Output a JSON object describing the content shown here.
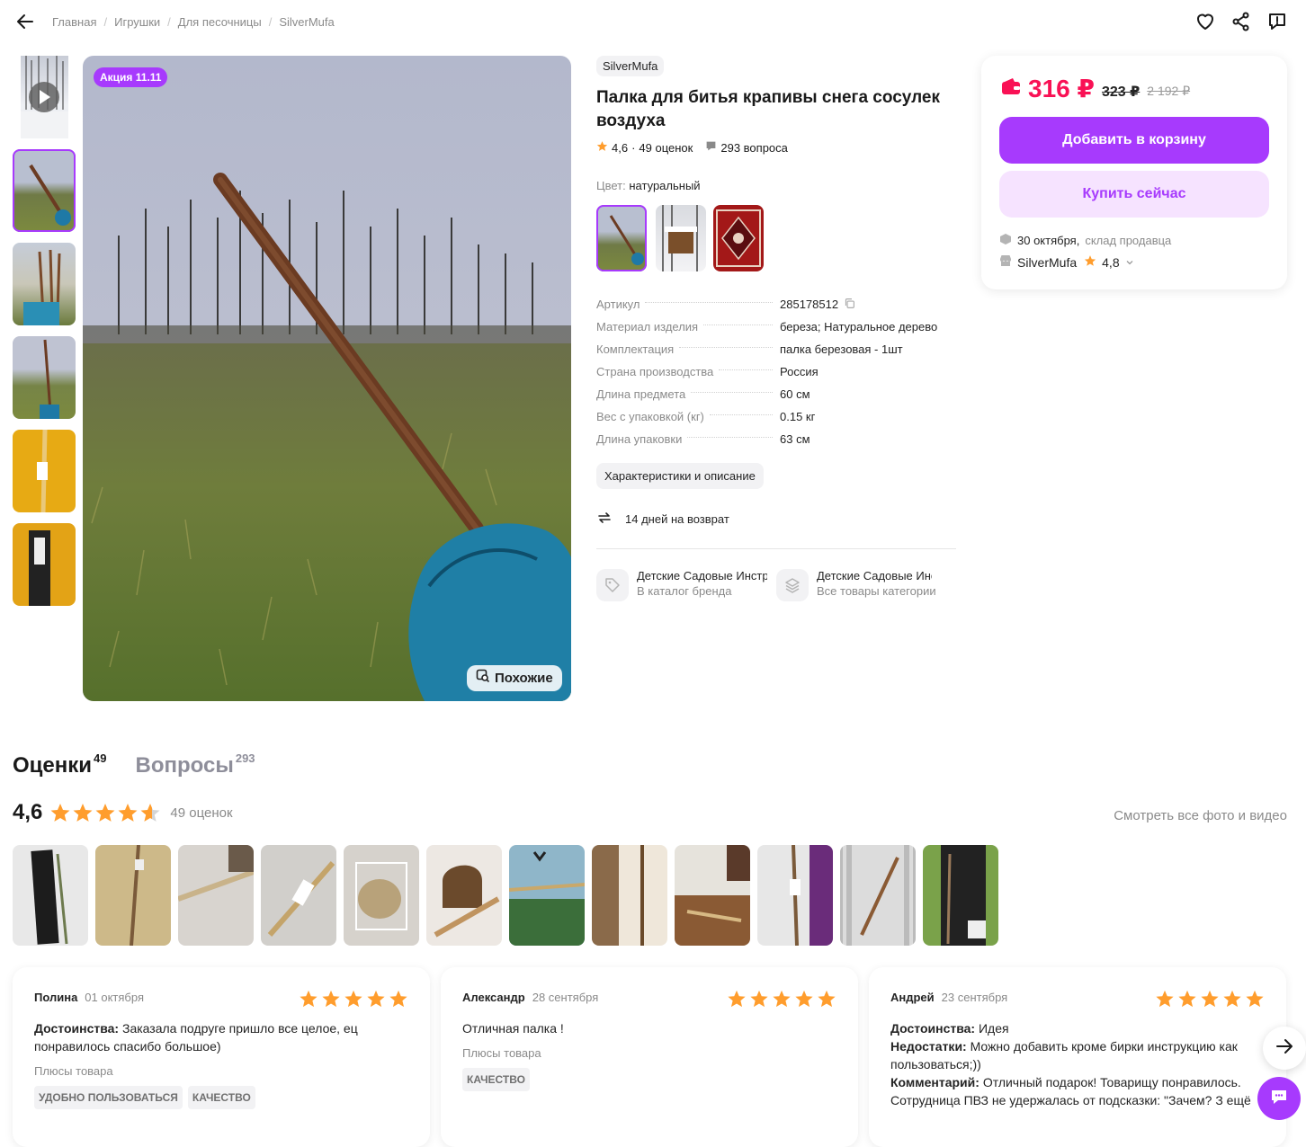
{
  "breadcrumb": [
    "Главная",
    "Игрушки",
    "Для песочницы",
    "SilverMufa"
  ],
  "gallery": {
    "promo_badge": "Акция 11.11",
    "similar_label": "Похожие"
  },
  "product": {
    "brand": "SilverMufa",
    "title": "Палка для битья крапивы снега сосулек воздуха",
    "rating": "4,6",
    "rating_count": "49 оценок",
    "questions": "293 вопроса",
    "color_label": "Цвет:",
    "color_value": "натуральный",
    "specs": [
      {
        "k": "Артикул",
        "v": "285178512"
      },
      {
        "k": "Материал изделия",
        "v": "береза; Натуральное дерево"
      },
      {
        "k": "Комплектация",
        "v": "палка березовая - 1шт"
      },
      {
        "k": "Страна производства",
        "v": "Россия"
      },
      {
        "k": "Длина предмета",
        "v": "60 см"
      },
      {
        "k": "Вес с упаковкой (кг)",
        "v": "0.15 кг"
      },
      {
        "k": "Длина упаковки",
        "v": "63 см"
      }
    ],
    "char_button": "Характеристики и описание",
    "returns": "14 дней на возврат",
    "links": [
      {
        "title": "Детские Садовые Инструменты",
        "sub": "В каталог бренда"
      },
      {
        "title": "Детские Садовые Инструменты",
        "sub": "Все товары категории"
      }
    ]
  },
  "buy": {
    "price": "316 ₽",
    "old_price": "323 ₽",
    "orig_price": "2 192 ₽",
    "cart_label": "Добавить в корзину",
    "buy_now_label": "Купить сейчас",
    "delivery_date": "30 октября,",
    "delivery_src": "склад продавца",
    "seller_name": "SilverMufa",
    "seller_rating": "4,8"
  },
  "reviews": {
    "tab_ratings": "Оценки",
    "tab_ratings_count": "49",
    "tab_questions": "Вопросы",
    "tab_questions_count": "293",
    "avg": "4,6",
    "count_text": "49 оценок",
    "see_all": "Смотреть все фото и видео",
    "plus_label": "Плюсы товара",
    "items": [
      {
        "name": "Полина",
        "date": "01 октября",
        "stars": 5,
        "lines": [
          {
            "b": "Достоинства:",
            "t": " Заказала подруге пришло все целое, ец понравилось спасибо большое)"
          }
        ],
        "tags": [
          "УДОБНО ПОЛЬЗОВАТЬСЯ",
          "КАЧЕСТВО"
        ]
      },
      {
        "name": "Александр",
        "date": "28 сентября",
        "stars": 5,
        "lines": [
          {
            "b": "",
            "t": "Отличная палка !"
          }
        ],
        "tags": [
          "КАЧЕСТВО"
        ]
      },
      {
        "name": "Андрей",
        "date": "23 сентября",
        "stars": 5,
        "lines": [
          {
            "b": "Достоинства:",
            "t": " Идея"
          },
          {
            "b": "Недостатки:",
            "t": " Можно добавить кроме бирки инструкцию как пользоваться;))"
          },
          {
            "b": "Комментарий:",
            "t": " Отличный подарок! Товарищу понравилось. Сотрудница ПВЗ не удержалась от подсказки: \"Зачем? З ещё"
          }
        ],
        "tags": []
      }
    ]
  },
  "colors": {
    "accent": "#a73afd",
    "price": "#f91155",
    "star": "#ff9d2d"
  }
}
